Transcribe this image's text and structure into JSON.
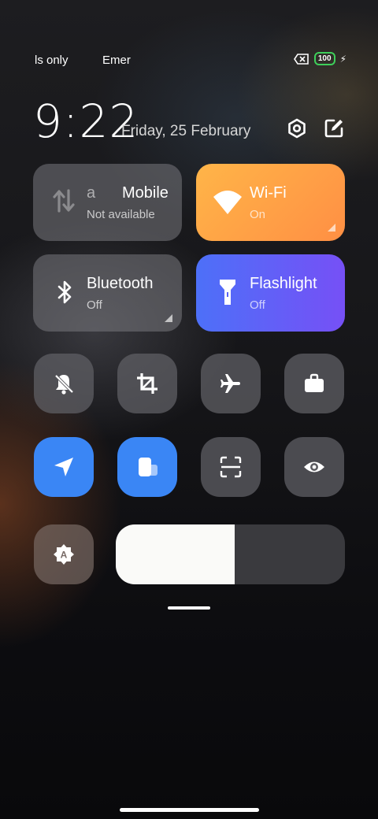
{
  "status_bar": {
    "left_text": "ls only",
    "mid_text": "Emer",
    "battery": "100"
  },
  "header": {
    "time": "9:22",
    "date": "Friday, 25 February"
  },
  "tiles": {
    "mobile": {
      "label": "Mobile",
      "status": "Not available"
    },
    "wifi": {
      "label": "Wi-Fi",
      "status": "On",
      "color": "#ffa04a"
    },
    "bluetooth": {
      "label": "Bluetooth",
      "status": "Off"
    },
    "flashlight": {
      "label": "Flashlight",
      "status": "Off",
      "color": "#5a6af8"
    }
  },
  "toggles": [
    {
      "icon": "bell-off-icon",
      "active": false
    },
    {
      "icon": "crop-icon",
      "active": false
    },
    {
      "icon": "airplane-icon",
      "active": false
    },
    {
      "icon": "briefcase-icon",
      "active": false
    },
    {
      "icon": "location-icon",
      "active": true
    },
    {
      "icon": "floating-window-icon",
      "active": true
    },
    {
      "icon": "scan-icon",
      "active": false
    },
    {
      "icon": "eye-icon",
      "active": false
    }
  ],
  "brightness": {
    "level_percent": 52
  },
  "accent_colors": {
    "blue": "#3a86f5",
    "battery_green": "#3ecf5a"
  }
}
